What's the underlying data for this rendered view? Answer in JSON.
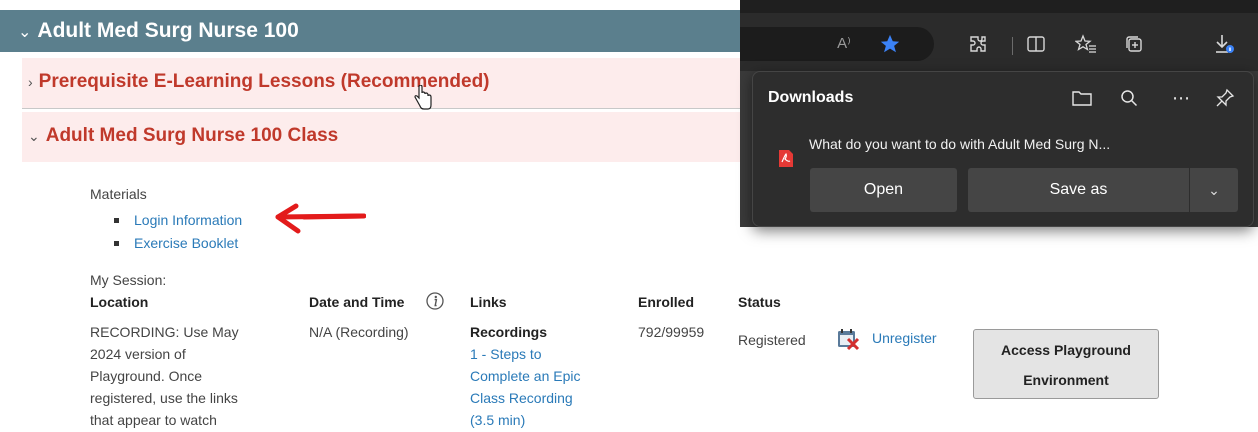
{
  "course": {
    "title": "Adult Med Surg Nurse 100"
  },
  "sections": [
    {
      "title": "Prerequisite E-Learning Lessons (Recommended)"
    },
    {
      "title": "Adult Med Surg Nurse 100 Class"
    }
  ],
  "materials": {
    "label": "Materials",
    "items": [
      "Login Information",
      "Exercise Booklet"
    ]
  },
  "session": {
    "label": "My Session:",
    "headers": {
      "location": "Location",
      "datetime": "Date and Time",
      "links": "Links",
      "enrolled": "Enrolled",
      "status": "Status"
    },
    "row": {
      "location_lines": [
        "RECORDING: Use May",
        "2024 version of",
        "Playground. Once",
        "registered, use the links",
        "that appear to watch"
      ],
      "datetime": "N/A (Recording)",
      "links_heading": "Recordings",
      "link_lines": [
        "1 - Steps to",
        "Complete an Epic",
        "Class Recording",
        "(3.5 min)"
      ],
      "enrolled": "792/99959",
      "status": "Registered",
      "unregister": "Unregister",
      "playground_lines": [
        "Access Playground",
        "Environment"
      ]
    }
  },
  "browser": {
    "read_aloud": "A⁾",
    "downloads": {
      "title": "Downloads",
      "question": "What do you want to do with Adult Med Surg N...",
      "open": "Open",
      "save_as": "Save as"
    }
  },
  "colors": {
    "course_header_bg": "#5b7f8d",
    "section_bg": "#fdecec",
    "section_title": "#c0392b",
    "link": "#2a7ab8",
    "annotation_arrow": "#e31b1b",
    "downloads_panel_bg": "#2d2d2d",
    "favorite_star": "#3b82f6"
  },
  "icons": [
    "chevron-down-icon",
    "chevron-right-icon",
    "hand-cursor-icon",
    "red-arrow-icon",
    "info-icon",
    "calendar-cancel-icon",
    "read-aloud-icon",
    "star-icon",
    "extensions-icon",
    "split-screen-icon",
    "favorites-icon",
    "collections-icon",
    "downloads-icon",
    "folder-icon",
    "search-icon",
    "more-icon",
    "pin-icon",
    "pdf-icon"
  ]
}
